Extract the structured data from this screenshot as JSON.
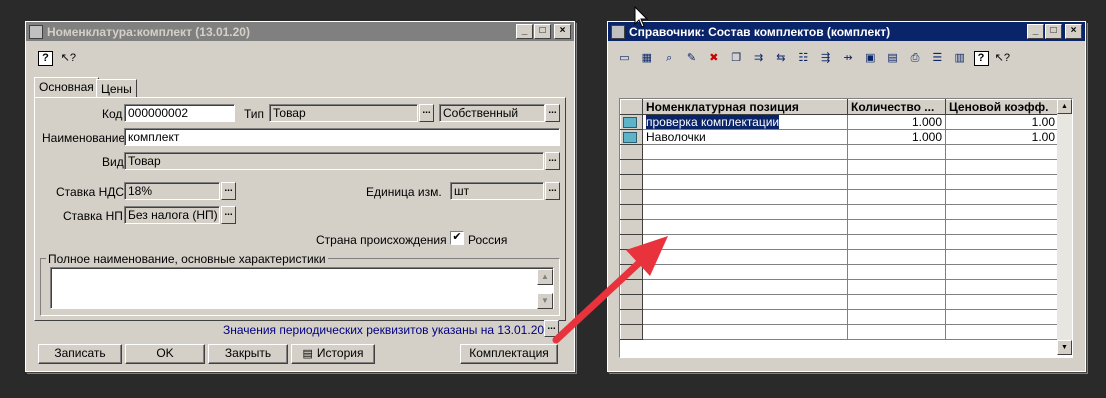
{
  "left_window": {
    "title": "Номенклатура:комплект (13.01.20)",
    "tabs": [
      "Основная",
      "Цены"
    ],
    "labels": {
      "code": "Код",
      "type": "Тип",
      "name": "Наименование",
      "kind": "Вид",
      "vat": "Ставка НДС",
      "unit": "Единица изм.",
      "np": "Ставка НП",
      "country": "Страна происхождения",
      "full_name": "Полное наименование, основные характеристики"
    },
    "values": {
      "code": "000000002",
      "type": "Товар",
      "ownership": "Собственный",
      "name": "комплект",
      "kind": "Товар",
      "vat": "18%",
      "unit": "шт",
      "np": "Без налога (НП)",
      "country": "Россия",
      "full_name": ""
    },
    "periodic_note": "Значения периодических реквизитов указаны на 13.01.2020",
    "buttons": {
      "save": "Записать",
      "ok": "OK",
      "close": "Закрыть",
      "history": "История",
      "kit": "Комплектация"
    }
  },
  "right_window": {
    "title": "Справочник: Состав комплектов (комплект)",
    "columns": [
      "Номенклатурная позиция",
      "Количество ...",
      "Ценовой коэфф."
    ],
    "rows": [
      {
        "item": "проверка комплектации",
        "qty": "1.000",
        "coef": "1.00"
      },
      {
        "item": "Наволочки",
        "qty": "1.000",
        "coef": "1.00"
      }
    ]
  },
  "colors": {
    "active_title": "#0a246a",
    "inactive_title": "#808080",
    "window_face": "#d4d0c8",
    "arrow": "#e8333c"
  }
}
